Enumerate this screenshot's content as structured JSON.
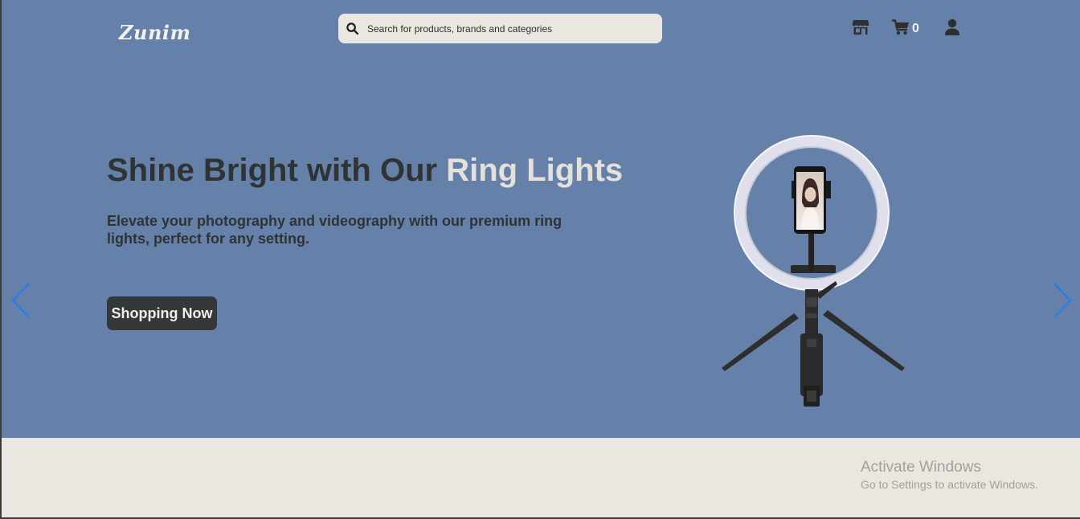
{
  "app": {
    "logo": "Zunim"
  },
  "header": {
    "search": {
      "placeholder": "Search for products, brands and categories"
    },
    "cart_count": "0",
    "icons": {
      "store": "store-icon",
      "cart": "cart-icon",
      "user": "user-icon",
      "search": "search-icon"
    }
  },
  "hero": {
    "headline_main": "Shine Bright with Our ",
    "headline_highlight": "Ring Lights",
    "subtext": "Elevate your photography and videography with our premium ring lights, perfect for any setting.",
    "cta_label": "Shopping Now",
    "prev_icon": "chevron-left-icon",
    "next_icon": "chevron-right-icon"
  },
  "colors": {
    "hero_bg": "#6581aa",
    "page_bg": "#ebe7e0",
    "text_dark": "#2f3333",
    "highlight": "#e4e0da",
    "arrow_blue": "#2a7de1"
  },
  "os_watermark": {
    "title": "Activate Windows",
    "subtitle": "Go to Settings to activate Windows."
  }
}
